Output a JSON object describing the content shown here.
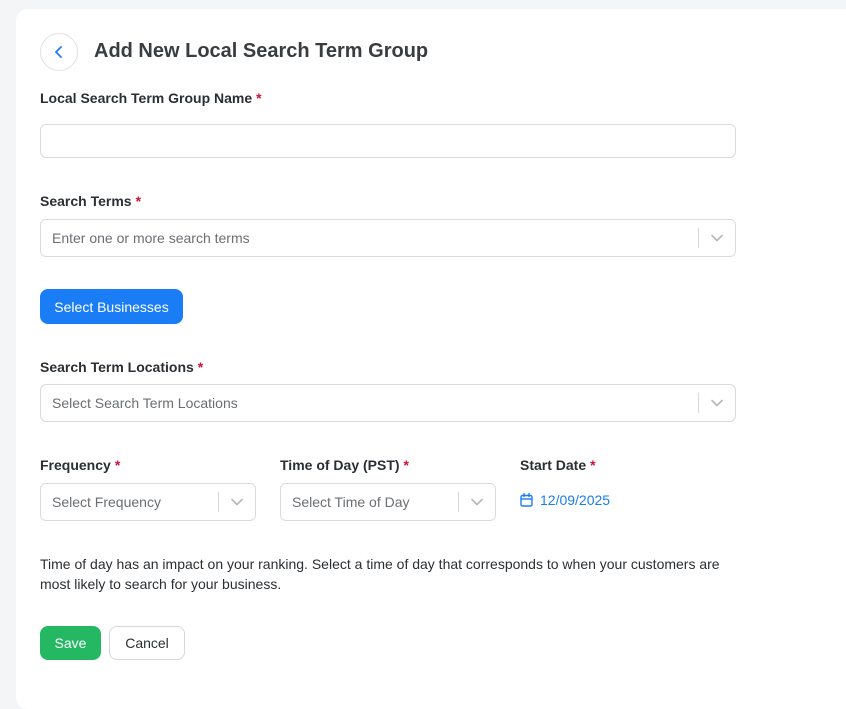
{
  "header": {
    "title": "Add New Local Search Term Group",
    "back_icon": "chevron-left-icon"
  },
  "form": {
    "required_marker": "*",
    "group_name": {
      "label": "Local Search Term Group Name",
      "value": "",
      "placeholder": ""
    },
    "search_terms": {
      "label": "Search Terms",
      "placeholder": "Enter one or more search terms"
    },
    "select_businesses_label": "Select Businesses",
    "locations": {
      "label": "Search Term Locations",
      "placeholder": "Select Search Term Locations"
    },
    "frequency": {
      "label": "Frequency",
      "placeholder": "Select Frequency"
    },
    "time_of_day": {
      "label": "Time of Day (PST)",
      "placeholder": "Select Time of Day"
    },
    "start_date": {
      "label": "Start Date",
      "value": "12/09/2025",
      "icon": "calendar-icon"
    },
    "help_text": "Time of day has an impact on your ranking. Select a time of day that corresponds to when your customers are most likely to search for your business.",
    "save_label": "Save",
    "cancel_label": "Cancel"
  },
  "colors": {
    "primary": "#1a7df5",
    "success": "#25b863",
    "required": "#d0103a"
  }
}
